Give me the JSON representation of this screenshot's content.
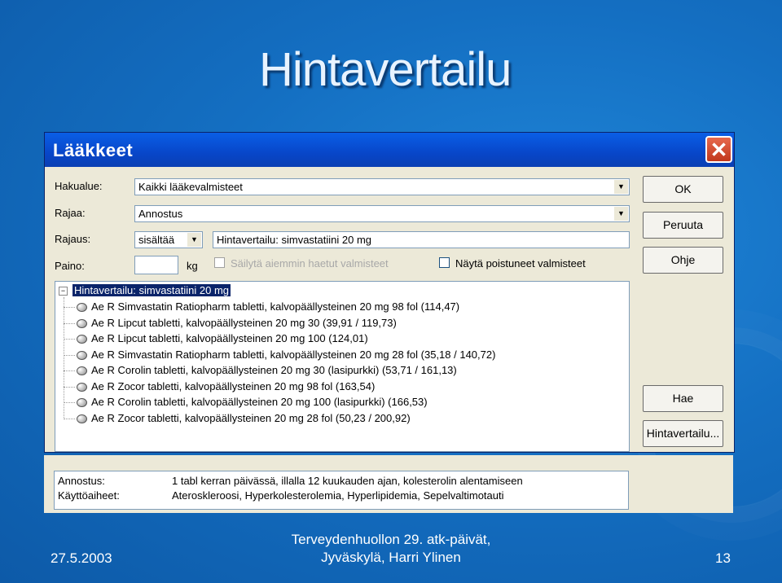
{
  "slide": {
    "title": "Hintavertailu",
    "footer_date": "27.5.2003",
    "footer_line1": "Terveydenhuollon 29. atk-päivät,",
    "footer_line2": "Jyväskylä, Harri Ylinen",
    "page_number": "13"
  },
  "dialog": {
    "title": "Lääkkeet",
    "close_glyph": "✕",
    "hakualue_label": "Hakualue:",
    "hakualue_value": "Kaikki lääkevalmisteet",
    "rajaa_label": "Rajaa:",
    "rajaa_value": "Annostus",
    "rajaus_label": "Rajaus:",
    "rajaus_mode": "sisältää",
    "rajaus_text": "Hintavertailu: simvastatiini 20 mg",
    "paino_label": "Paino:",
    "paino_value": "",
    "paino_unit": "kg",
    "keep_previous_label": "Säilytä aiemmin haetut valmisteet",
    "show_discontinued_label": "Näytä poistuneet valmisteet",
    "buttons": {
      "ok": "OK",
      "cancel": "Peruuta",
      "help": "Ohje",
      "search": "Hae",
      "price_compare": "Hintavertailu..."
    },
    "dropdown_glyph": "▼",
    "tree": {
      "expand_glyph": "−",
      "root": "Hintavertailu: simvastatiini 20 mg",
      "items": [
        "Ae R  Simvastatin Ratiopharm tabletti, kalvopäällysteinen 20 mg  98 fol  (114,47)",
        "Ae R  Lipcut tabletti, kalvopäällysteinen 20 mg  30  (39,91 / 119,73)",
        "Ae R  Lipcut tabletti, kalvopäällysteinen 20 mg  100  (124,01)",
        "Ae R  Simvastatin Ratiopharm tabletti, kalvopäällysteinen 20 mg  28 fol  (35,18 / 140,72)",
        "Ae R  Corolin tabletti, kalvopäällysteinen 20 mg  30 (lasipurkki)  (53,71 / 161,13)",
        "Ae R  Zocor tabletti, kalvopäällysteinen 20 mg  98 fol  (163,54)",
        "Ae R  Corolin tabletti, kalvopäällysteinen 20 mg  100 (lasipurkki)  (166,53)",
        "Ae R  Zocor tabletti, kalvopäällysteinen 20 mg  28 fol  (50,23 / 200,92)"
      ]
    },
    "info": {
      "annostus_label": "Annostus:",
      "annostus_value": "1 tabl kerran päivässä, illalla 12 kuukauden ajan, kolesterolin alentamiseen",
      "kayttoaiheet_label": "Käyttöaiheet:",
      "kayttoaiheet_value": "Ateroskleroosi, Hyperkolesterolemia, Hyperlipidemia, Sepelvaltimotauti"
    }
  },
  "colors": {
    "background": "#146fc2",
    "titlebar": "#0846c9",
    "dialog": "#ece9d8",
    "selection": "#0a246a"
  }
}
